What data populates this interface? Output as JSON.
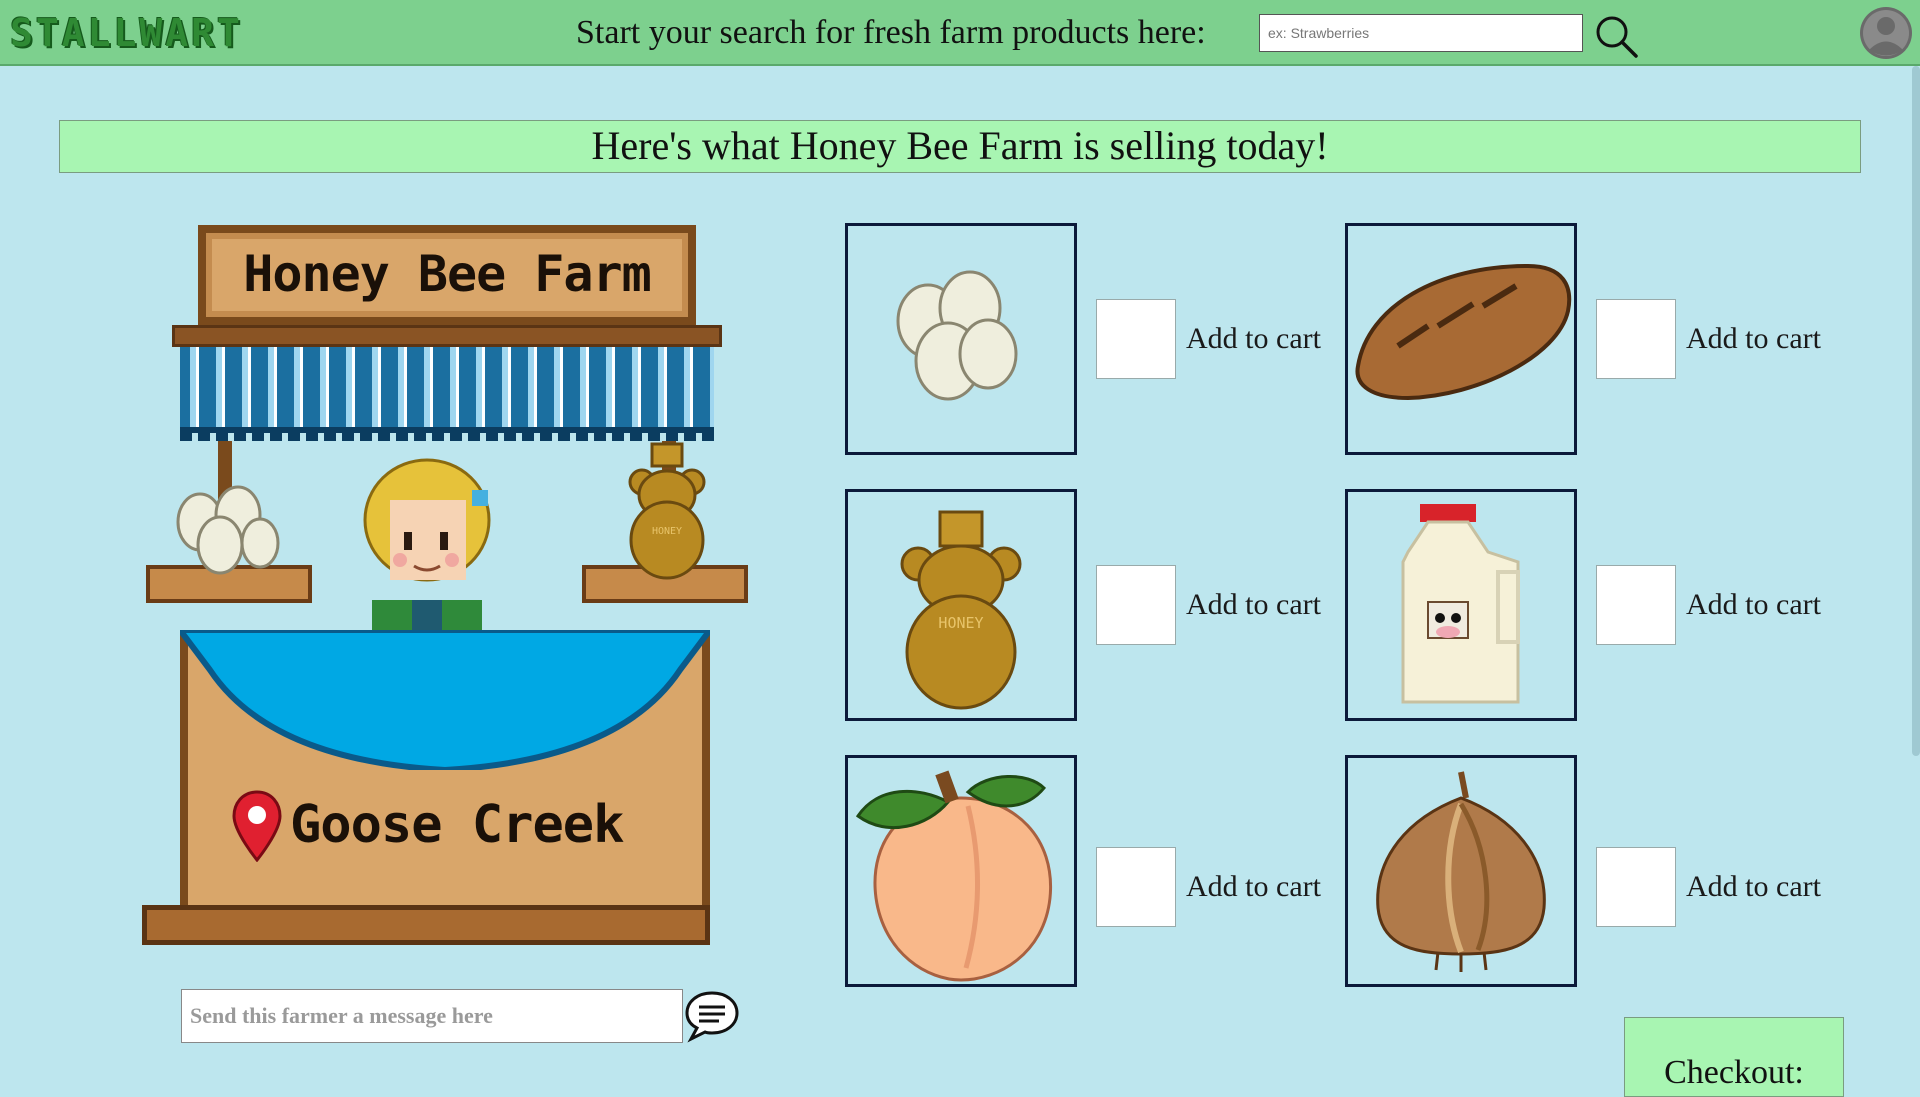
{
  "header": {
    "logo_text": "STALLWART",
    "search_prompt": "Start your search for fresh farm products here:",
    "search_placeholder": "ex: Strawberries",
    "search_icon": "search-icon",
    "avatar_icon": "user-avatar-icon"
  },
  "banner": {
    "text": "Here's what Honey Bee Farm is selling today!"
  },
  "stall": {
    "farm_name": "Honey Bee Farm",
    "location": "Goose Creek"
  },
  "message": {
    "placeholder": "Send this farmer a message here",
    "send_icon": "chat-bubble-icon"
  },
  "products": [
    {
      "name": "eggs",
      "add_label": "Add to cart",
      "checked": false
    },
    {
      "name": "bread",
      "add_label": "Add to cart",
      "checked": false
    },
    {
      "name": "honey",
      "add_label": "Add to cart",
      "checked": false
    },
    {
      "name": "milk",
      "add_label": "Add to cart",
      "checked": false
    },
    {
      "name": "peach",
      "add_label": "Add to cart",
      "checked": false
    },
    {
      "name": "onion",
      "add_label": "Add to cart",
      "checked": false
    }
  ],
  "checkout": {
    "label": "Checkout:"
  },
  "colors": {
    "topbar": "#7dd08e",
    "background": "#bde6ee",
    "banner": "#a8f5b2",
    "box_border": "#0c1a3a"
  }
}
